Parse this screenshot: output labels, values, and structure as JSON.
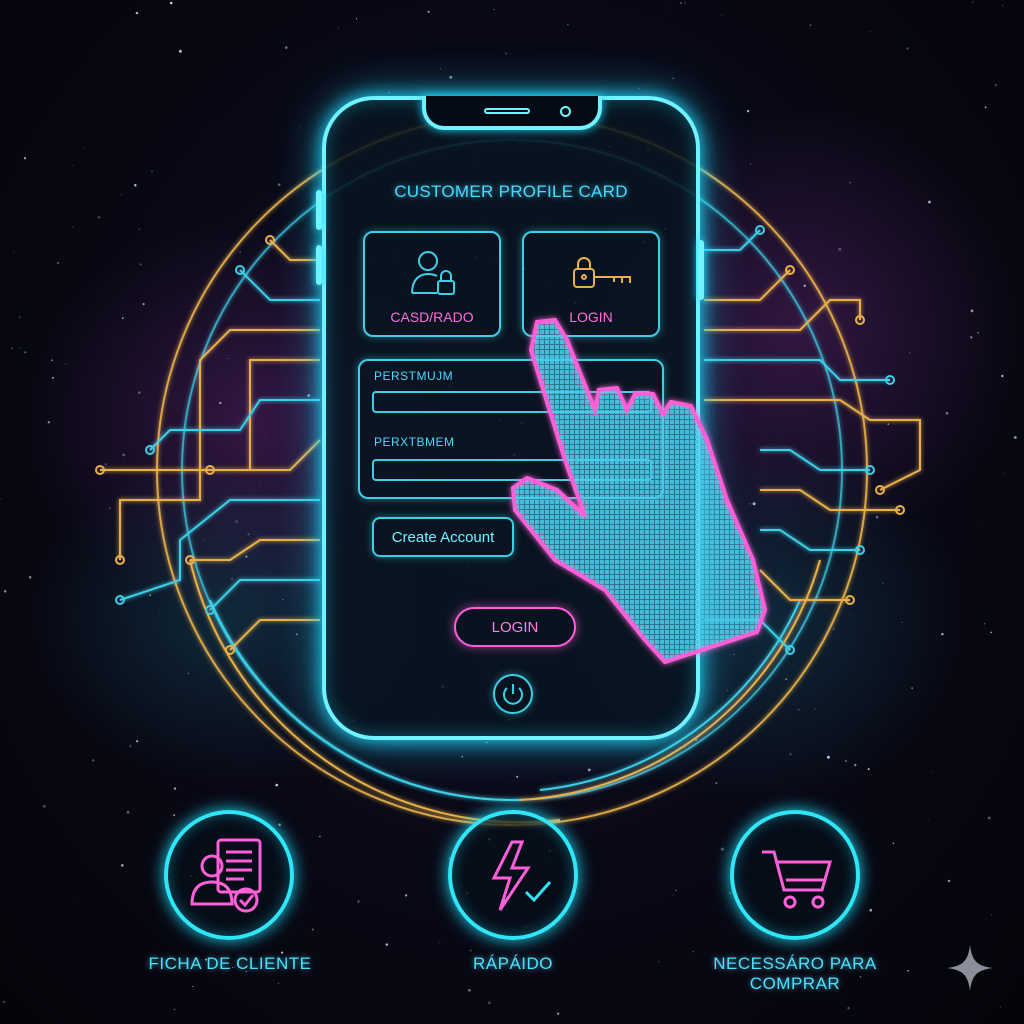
{
  "phone": {
    "title": "CUSTOMER PROFILE CARD",
    "tiles": [
      {
        "label": "CASD/RADO",
        "icon": "user-lock-icon"
      },
      {
        "label": "LOGIN",
        "icon": "key-lock-icon"
      }
    ],
    "fields": [
      {
        "label": "PERSTMUJM",
        "value": ""
      },
      {
        "label": "PERXTBMEM",
        "value": ""
      }
    ],
    "create_account_label": "Create Account",
    "login_label": "LOGIN"
  },
  "features": [
    {
      "label": "FICHA DE CLIENTE",
      "icon": "customer-file-icon"
    },
    {
      "label": "RÁPÁIDO",
      "icon": "lightning-check-icon"
    },
    {
      "label_line1": "NECESSÁRO PARA",
      "label_line2": "COMPRAR",
      "icon": "shopping-cart-icon"
    }
  ],
  "colors": {
    "cyan": "#6ef3ff",
    "magenta": "#ff5fd8",
    "gold": "#e9b04a",
    "background": "#04040a"
  }
}
